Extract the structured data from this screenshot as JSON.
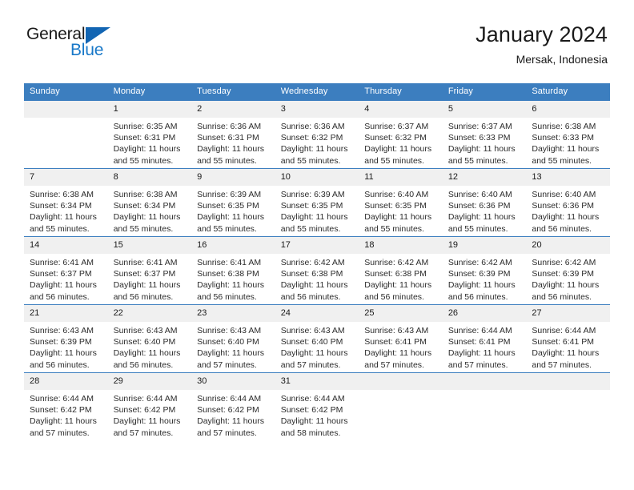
{
  "brand": {
    "name_part1": "General",
    "name_part2": "Blue",
    "accent_color": "#1878c8",
    "triangle_color": "#1265b3"
  },
  "header": {
    "title": "January 2024",
    "subtitle": "Mersak, Indonesia"
  },
  "calendar": {
    "header_bg": "#3c7ebf",
    "daynum_bg": "#f0f0f0",
    "weekdays": [
      "Sunday",
      "Monday",
      "Tuesday",
      "Wednesday",
      "Thursday",
      "Friday",
      "Saturday"
    ],
    "weeks": [
      [
        {
          "day": "",
          "sunrise": "",
          "sunset": "",
          "daylight_line1": "",
          "daylight_line2": ""
        },
        {
          "day": "1",
          "sunrise": "Sunrise: 6:35 AM",
          "sunset": "Sunset: 6:31 PM",
          "daylight_line1": "Daylight: 11 hours",
          "daylight_line2": "and 55 minutes."
        },
        {
          "day": "2",
          "sunrise": "Sunrise: 6:36 AM",
          "sunset": "Sunset: 6:31 PM",
          "daylight_line1": "Daylight: 11 hours",
          "daylight_line2": "and 55 minutes."
        },
        {
          "day": "3",
          "sunrise": "Sunrise: 6:36 AM",
          "sunset": "Sunset: 6:32 PM",
          "daylight_line1": "Daylight: 11 hours",
          "daylight_line2": "and 55 minutes."
        },
        {
          "day": "4",
          "sunrise": "Sunrise: 6:37 AM",
          "sunset": "Sunset: 6:32 PM",
          "daylight_line1": "Daylight: 11 hours",
          "daylight_line2": "and 55 minutes."
        },
        {
          "day": "5",
          "sunrise": "Sunrise: 6:37 AM",
          "sunset": "Sunset: 6:33 PM",
          "daylight_line1": "Daylight: 11 hours",
          "daylight_line2": "and 55 minutes."
        },
        {
          "day": "6",
          "sunrise": "Sunrise: 6:38 AM",
          "sunset": "Sunset: 6:33 PM",
          "daylight_line1": "Daylight: 11 hours",
          "daylight_line2": "and 55 minutes."
        }
      ],
      [
        {
          "day": "7",
          "sunrise": "Sunrise: 6:38 AM",
          "sunset": "Sunset: 6:34 PM",
          "daylight_line1": "Daylight: 11 hours",
          "daylight_line2": "and 55 minutes."
        },
        {
          "day": "8",
          "sunrise": "Sunrise: 6:38 AM",
          "sunset": "Sunset: 6:34 PM",
          "daylight_line1": "Daylight: 11 hours",
          "daylight_line2": "and 55 minutes."
        },
        {
          "day": "9",
          "sunrise": "Sunrise: 6:39 AM",
          "sunset": "Sunset: 6:35 PM",
          "daylight_line1": "Daylight: 11 hours",
          "daylight_line2": "and 55 minutes."
        },
        {
          "day": "10",
          "sunrise": "Sunrise: 6:39 AM",
          "sunset": "Sunset: 6:35 PM",
          "daylight_line1": "Daylight: 11 hours",
          "daylight_line2": "and 55 minutes."
        },
        {
          "day": "11",
          "sunrise": "Sunrise: 6:40 AM",
          "sunset": "Sunset: 6:35 PM",
          "daylight_line1": "Daylight: 11 hours",
          "daylight_line2": "and 55 minutes."
        },
        {
          "day": "12",
          "sunrise": "Sunrise: 6:40 AM",
          "sunset": "Sunset: 6:36 PM",
          "daylight_line1": "Daylight: 11 hours",
          "daylight_line2": "and 55 minutes."
        },
        {
          "day": "13",
          "sunrise": "Sunrise: 6:40 AM",
          "sunset": "Sunset: 6:36 PM",
          "daylight_line1": "Daylight: 11 hours",
          "daylight_line2": "and 56 minutes."
        }
      ],
      [
        {
          "day": "14",
          "sunrise": "Sunrise: 6:41 AM",
          "sunset": "Sunset: 6:37 PM",
          "daylight_line1": "Daylight: 11 hours",
          "daylight_line2": "and 56 minutes."
        },
        {
          "day": "15",
          "sunrise": "Sunrise: 6:41 AM",
          "sunset": "Sunset: 6:37 PM",
          "daylight_line1": "Daylight: 11 hours",
          "daylight_line2": "and 56 minutes."
        },
        {
          "day": "16",
          "sunrise": "Sunrise: 6:41 AM",
          "sunset": "Sunset: 6:38 PM",
          "daylight_line1": "Daylight: 11 hours",
          "daylight_line2": "and 56 minutes."
        },
        {
          "day": "17",
          "sunrise": "Sunrise: 6:42 AM",
          "sunset": "Sunset: 6:38 PM",
          "daylight_line1": "Daylight: 11 hours",
          "daylight_line2": "and 56 minutes."
        },
        {
          "day": "18",
          "sunrise": "Sunrise: 6:42 AM",
          "sunset": "Sunset: 6:38 PM",
          "daylight_line1": "Daylight: 11 hours",
          "daylight_line2": "and 56 minutes."
        },
        {
          "day": "19",
          "sunrise": "Sunrise: 6:42 AM",
          "sunset": "Sunset: 6:39 PM",
          "daylight_line1": "Daylight: 11 hours",
          "daylight_line2": "and 56 minutes."
        },
        {
          "day": "20",
          "sunrise": "Sunrise: 6:42 AM",
          "sunset": "Sunset: 6:39 PM",
          "daylight_line1": "Daylight: 11 hours",
          "daylight_line2": "and 56 minutes."
        }
      ],
      [
        {
          "day": "21",
          "sunrise": "Sunrise: 6:43 AM",
          "sunset": "Sunset: 6:39 PM",
          "daylight_line1": "Daylight: 11 hours",
          "daylight_line2": "and 56 minutes."
        },
        {
          "day": "22",
          "sunrise": "Sunrise: 6:43 AM",
          "sunset": "Sunset: 6:40 PM",
          "daylight_line1": "Daylight: 11 hours",
          "daylight_line2": "and 56 minutes."
        },
        {
          "day": "23",
          "sunrise": "Sunrise: 6:43 AM",
          "sunset": "Sunset: 6:40 PM",
          "daylight_line1": "Daylight: 11 hours",
          "daylight_line2": "and 57 minutes."
        },
        {
          "day": "24",
          "sunrise": "Sunrise: 6:43 AM",
          "sunset": "Sunset: 6:40 PM",
          "daylight_line1": "Daylight: 11 hours",
          "daylight_line2": "and 57 minutes."
        },
        {
          "day": "25",
          "sunrise": "Sunrise: 6:43 AM",
          "sunset": "Sunset: 6:41 PM",
          "daylight_line1": "Daylight: 11 hours",
          "daylight_line2": "and 57 minutes."
        },
        {
          "day": "26",
          "sunrise": "Sunrise: 6:44 AM",
          "sunset": "Sunset: 6:41 PM",
          "daylight_line1": "Daylight: 11 hours",
          "daylight_line2": "and 57 minutes."
        },
        {
          "day": "27",
          "sunrise": "Sunrise: 6:44 AM",
          "sunset": "Sunset: 6:41 PM",
          "daylight_line1": "Daylight: 11 hours",
          "daylight_line2": "and 57 minutes."
        }
      ],
      [
        {
          "day": "28",
          "sunrise": "Sunrise: 6:44 AM",
          "sunset": "Sunset: 6:42 PM",
          "daylight_line1": "Daylight: 11 hours",
          "daylight_line2": "and 57 minutes."
        },
        {
          "day": "29",
          "sunrise": "Sunrise: 6:44 AM",
          "sunset": "Sunset: 6:42 PM",
          "daylight_line1": "Daylight: 11 hours",
          "daylight_line2": "and 57 minutes."
        },
        {
          "day": "30",
          "sunrise": "Sunrise: 6:44 AM",
          "sunset": "Sunset: 6:42 PM",
          "daylight_line1": "Daylight: 11 hours",
          "daylight_line2": "and 57 minutes."
        },
        {
          "day": "31",
          "sunrise": "Sunrise: 6:44 AM",
          "sunset": "Sunset: 6:42 PM",
          "daylight_line1": "Daylight: 11 hours",
          "daylight_line2": "and 58 minutes."
        },
        {
          "day": "",
          "sunrise": "",
          "sunset": "",
          "daylight_line1": "",
          "daylight_line2": ""
        },
        {
          "day": "",
          "sunrise": "",
          "sunset": "",
          "daylight_line1": "",
          "daylight_line2": ""
        },
        {
          "day": "",
          "sunrise": "",
          "sunset": "",
          "daylight_line1": "",
          "daylight_line2": ""
        }
      ]
    ]
  }
}
